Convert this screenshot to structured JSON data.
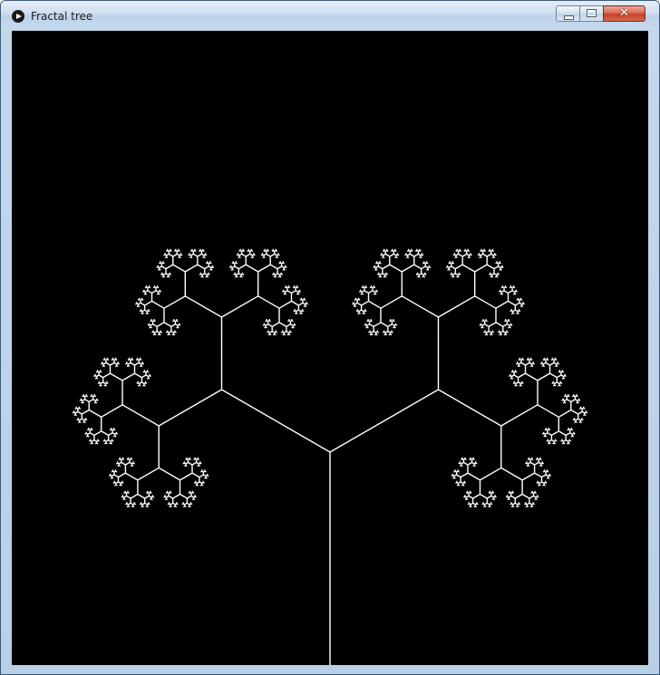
{
  "window": {
    "title": "Fractal tree",
    "app_icon": "play-icon"
  },
  "controls": {
    "minimize": "minimize-icon",
    "maximize": "maximize-icon",
    "close": "close-icon",
    "close_glyph": "✕"
  },
  "colors": {
    "canvas_background": "#000000",
    "tree_stroke": "#ffffff"
  },
  "fractal": {
    "type": "ternary tree",
    "branches_per_node": 3,
    "depth": 10,
    "branch_angles_deg": [
      -120,
      0,
      120
    ],
    "length_ratio": 0.5
  }
}
